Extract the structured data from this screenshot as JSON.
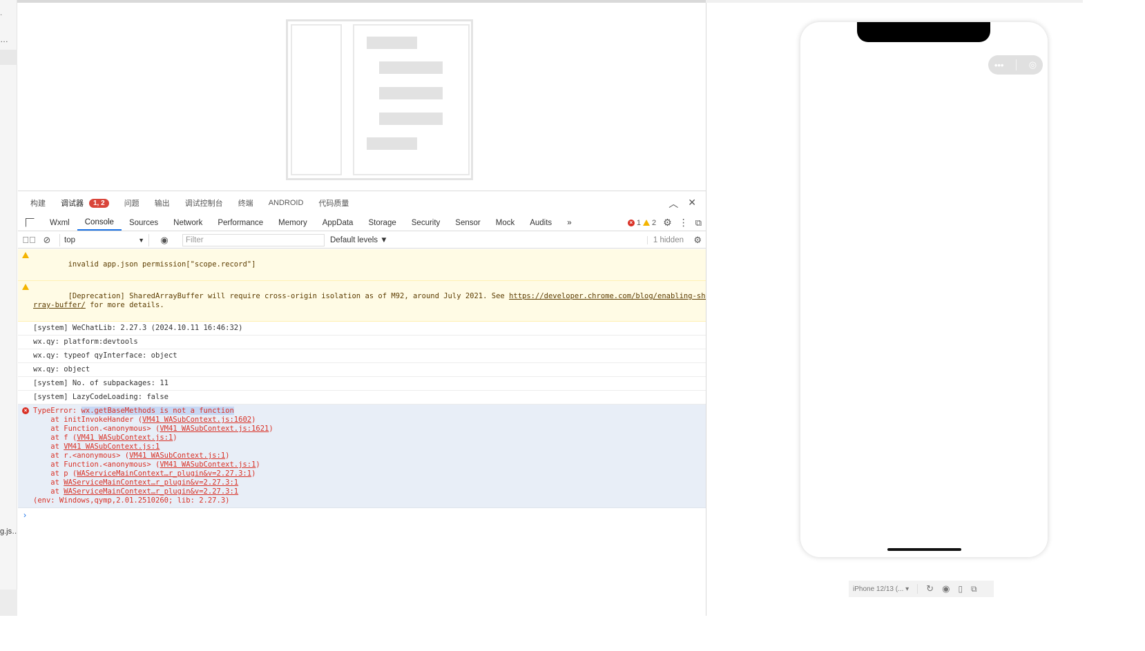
{
  "gutter": {
    "g1": "·",
    "g2": "…",
    "g4": "g.js…"
  },
  "devtools": {
    "top_tabs": [
      {
        "label": "构建"
      },
      {
        "label": "调试器",
        "badge": "1, 2"
      },
      {
        "label": "问题"
      },
      {
        "label": "输出"
      },
      {
        "label": "调试控制台"
      },
      {
        "label": "终端"
      },
      {
        "label": "ANDROID"
      },
      {
        "label": "代码质量"
      }
    ],
    "panel_tabs": [
      "Wxml",
      "Console",
      "Sources",
      "Network",
      "Performance",
      "Memory",
      "AppData",
      "Storage",
      "Security",
      "Sensor",
      "Mock",
      "Audits"
    ],
    "more_tabs": "»",
    "error_count": "1",
    "warning_count": "2",
    "context": "top",
    "filter_placeholder": "Filter",
    "levels": "Default levels ▼",
    "hidden_count": "1 hidden"
  },
  "console": {
    "lines": [
      {
        "type": "warn",
        "text": "invalid app.json permission[\"scope.record\"]"
      },
      {
        "type": "warn",
        "pre": "[Deprecation] SharedArrayBuffer will require cross-origin isolation as of M92, around July 2021. See ",
        "link": "https://developer.chrome.com/blog/enabling-shared-a",
        "link2": "rray-buffer/",
        "post": " for more details."
      },
      {
        "type": "log",
        "text": "[system] WeChatLib: 2.27.3 (2024.10.11 16:46:32)"
      },
      {
        "type": "log",
        "text": "wx.qy: platform:devtools"
      },
      {
        "type": "log",
        "text": "wx.qy: typeof qyInterface: object"
      },
      {
        "type": "log",
        "text": "wx.qy: object"
      },
      {
        "type": "log",
        "text": "[system] No. of subpackages: 11"
      },
      {
        "type": "log",
        "text": "[system] LazyCodeLoading: false"
      }
    ],
    "error": {
      "prefix": "TypeError: ",
      "highlight": "wx.getBaseMethods is not a function",
      "stack": [
        {
          "pre": "    at initInvokeHander (",
          "link": "VM41 WASubContext.js:1602",
          "post": ")"
        },
        {
          "pre": "    at Function.<anonymous> (",
          "link": "VM41 WASubContext.js:1621",
          "post": ")"
        },
        {
          "pre": "    at f (",
          "link": "VM41 WASubContext.js:1",
          "post": ")"
        },
        {
          "pre": "    at ",
          "link": "VM41 WASubContext.js:1",
          "post": ""
        },
        {
          "pre": "    at r.<anonymous> (",
          "link": "VM41 WASubContext.js:1",
          "post": ")"
        },
        {
          "pre": "    at Function.<anonymous> (",
          "link": "VM41 WASubContext.js:1",
          "post": ")"
        },
        {
          "pre": "    at p (",
          "link": "WAServiceMainContext…r_plugin&v=2.27.3:1",
          "post": ")"
        },
        {
          "pre": "    at ",
          "link": "WAServiceMainContext…r_plugin&v=2.27.3:1",
          "post": ""
        },
        {
          "pre": "    at ",
          "link": "WAServiceMainContext…r_plugin&v=2.27.3:1",
          "post": ""
        }
      ],
      "env": "(env: Windows,qymp,2.01.2510260; lib: 2.27.3)"
    },
    "prompt": "›"
  },
  "simulator": {
    "capsule_more": "•••",
    "device": "iPhone 12/13 (... ▾"
  },
  "colors": {
    "accent": "#1a73e8",
    "error": "#d93025",
    "warning": "#f4b400",
    "badge": "#d9453a"
  }
}
